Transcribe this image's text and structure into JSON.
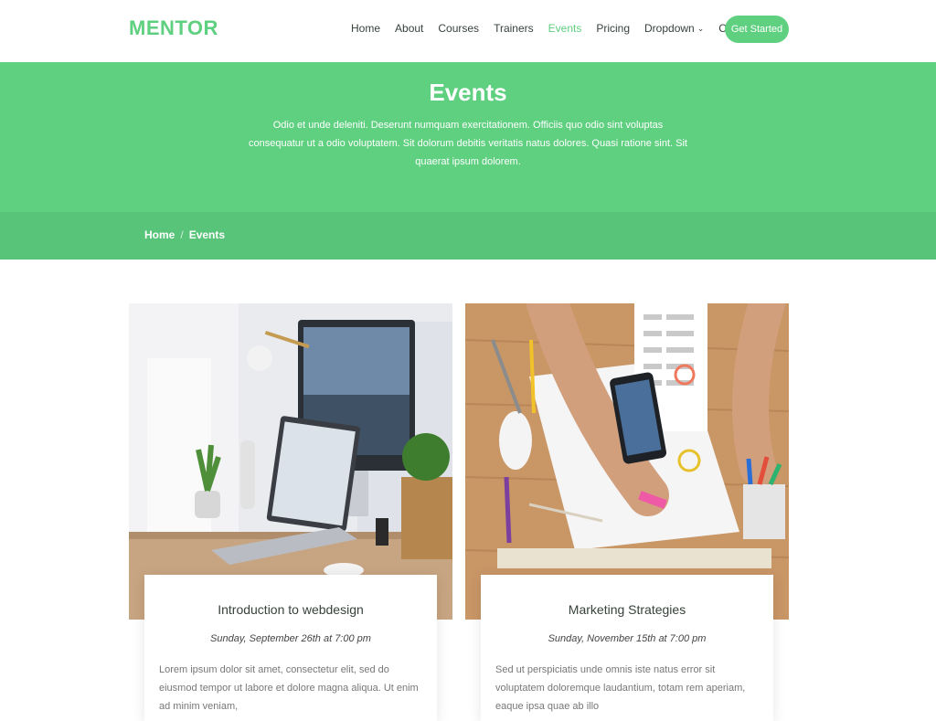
{
  "header": {
    "logo": "MENTOR",
    "nav": [
      {
        "label": "Home"
      },
      {
        "label": "About"
      },
      {
        "label": "Courses"
      },
      {
        "label": "Trainers"
      },
      {
        "label": "Events",
        "active": true
      },
      {
        "label": "Pricing"
      },
      {
        "label": "Dropdown",
        "has_chevron": true
      },
      {
        "label": "Contact"
      }
    ],
    "cta": "Get Started"
  },
  "hero": {
    "title": "Events",
    "subtitle": "Odio et unde deleniti. Deserunt numquam exercitationem. Officiis quo odio sint voluptas consequatur ut a odio voluptatem. Sit dolorum debitis veritatis natus dolores. Quasi ratione sint. Sit quaerat ipsum dolorem."
  },
  "breadcrumb": {
    "home": "Home",
    "separator": "/",
    "current": "Events"
  },
  "events": [
    {
      "title": "Introduction to webdesign",
      "date": "Sunday, September 26th at 7:00 pm",
      "description": "Lorem ipsum dolor sit amet, consectetur elit, sed do eiusmod tempor ut labore et dolore magna aliqua. Ut enim ad minim veniam,"
    },
    {
      "title": "Marketing Strategies",
      "date": "Sunday, November 15th at 7:00 pm",
      "description": "Sed ut perspiciatis unde omnis iste natus error sit voluptatem doloremque laudantium, totam rem aperiam, eaque ipsa quae ab illo"
    }
  ],
  "colors": {
    "accent": "#5fcf80",
    "breadcrumb_bg": "#58c479",
    "text": "#37423b"
  }
}
